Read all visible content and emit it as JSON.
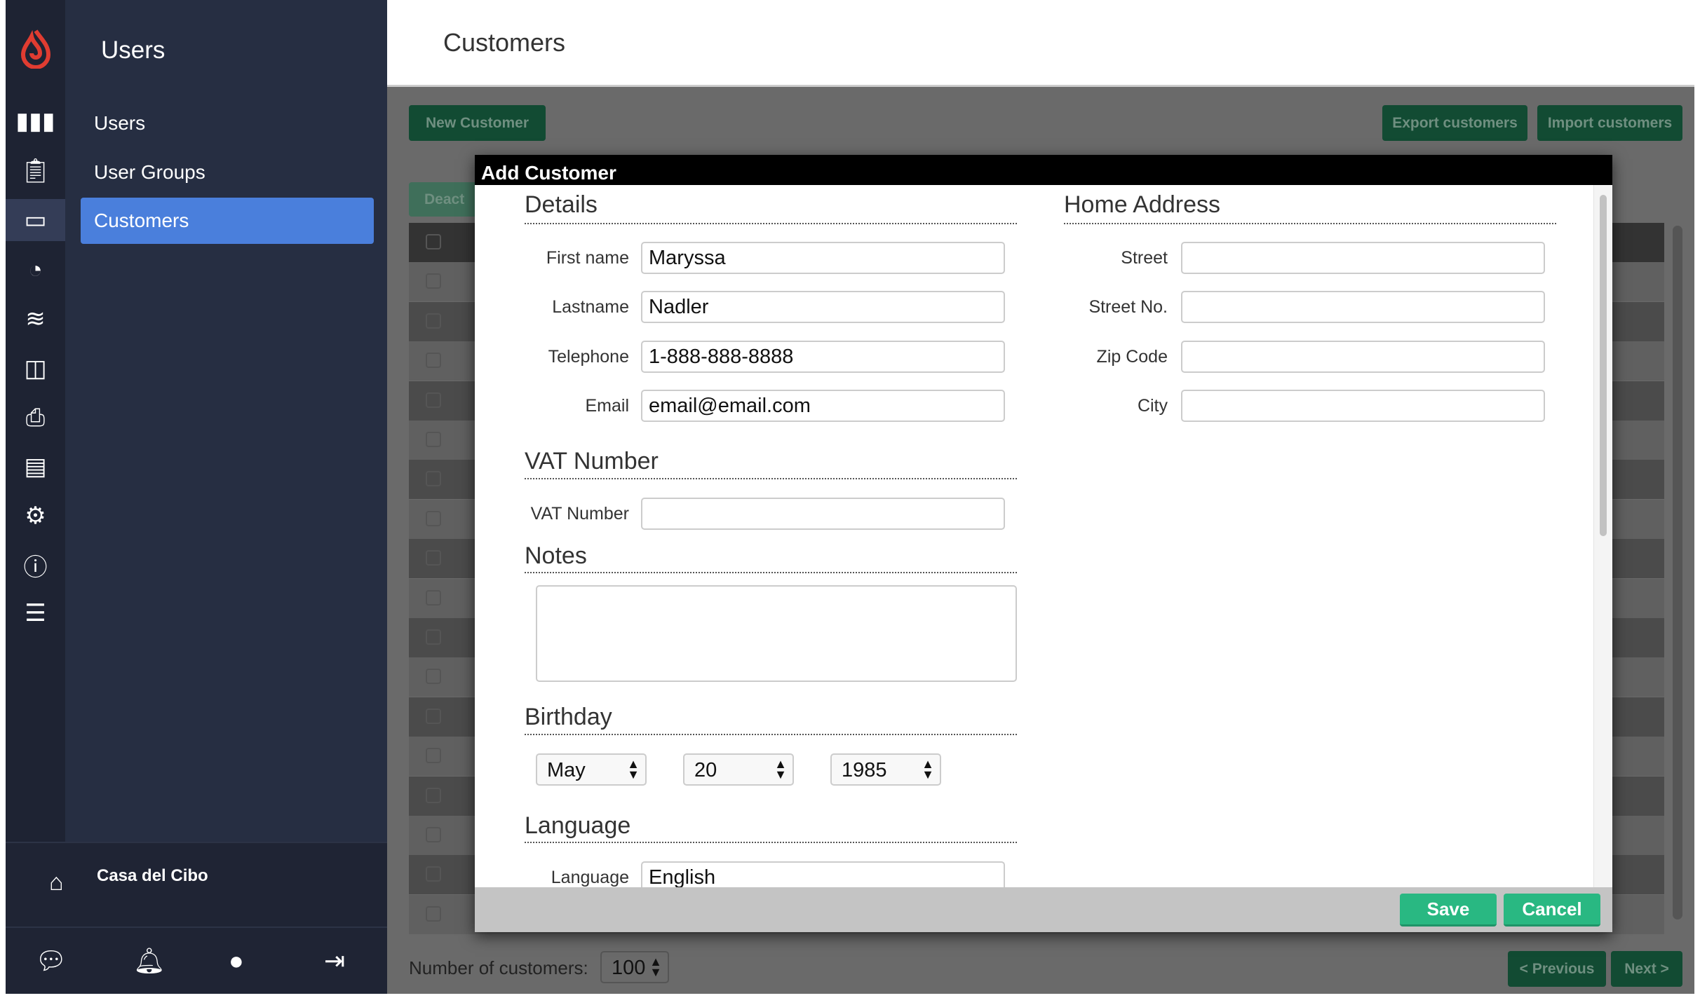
{
  "sidebar": {
    "title": "Users",
    "items": [
      {
        "label": "Users"
      },
      {
        "label": "User Groups"
      },
      {
        "label": "Customers",
        "active": true
      }
    ],
    "rail_icons": [
      "logo-icon",
      "reports-icon",
      "clipboard-icon",
      "customer-card-icon",
      "restaurant-icon",
      "layers-icon",
      "devices-icon",
      "printer-icon",
      "payment-icon",
      "gear-icon",
      "help-icon",
      "list-icon"
    ],
    "store": "Casa del Cibo",
    "bottom_icons": [
      "chat-icon",
      "bell-icon",
      "user-icon",
      "logout-icon"
    ]
  },
  "header": {
    "title": "Customers"
  },
  "toolbar": {
    "new": "New Customer",
    "export": "Export customers",
    "import": "Import customers",
    "deactivate": "Deact"
  },
  "footer": {
    "count_label": "Number of customers:",
    "count_value": "100",
    "previous": "< Previous",
    "next": "Next >"
  },
  "modal": {
    "title": "Add Customer",
    "details": {
      "heading": "Details",
      "first_name_label": "First name",
      "first_name": "Maryssa",
      "lastname_label": "Lastname",
      "lastname": "Nadler",
      "telephone_label": "Telephone",
      "telephone": "1-888-888-8888",
      "email_label": "Email",
      "email": "email@email.com"
    },
    "address": {
      "heading": "Home Address",
      "street_label": "Street",
      "street": "",
      "street_no_label": "Street No.",
      "street_no": "",
      "zip_label": "Zip Code",
      "zip": "",
      "city_label": "City",
      "city": ""
    },
    "vat": {
      "heading": "VAT Number",
      "label": "VAT Number",
      "value": ""
    },
    "notes": {
      "heading": "Notes",
      "value": ""
    },
    "birthday": {
      "heading": "Birthday",
      "month": "May",
      "day": "20",
      "year": "1985"
    },
    "language": {
      "heading": "Language",
      "label": "Language",
      "value": "English"
    },
    "save": "Save",
    "cancel": "Cancel"
  },
  "colors": {
    "accent": "#4a7fdc",
    "save": "#29b882",
    "brand": "#e03c31"
  }
}
